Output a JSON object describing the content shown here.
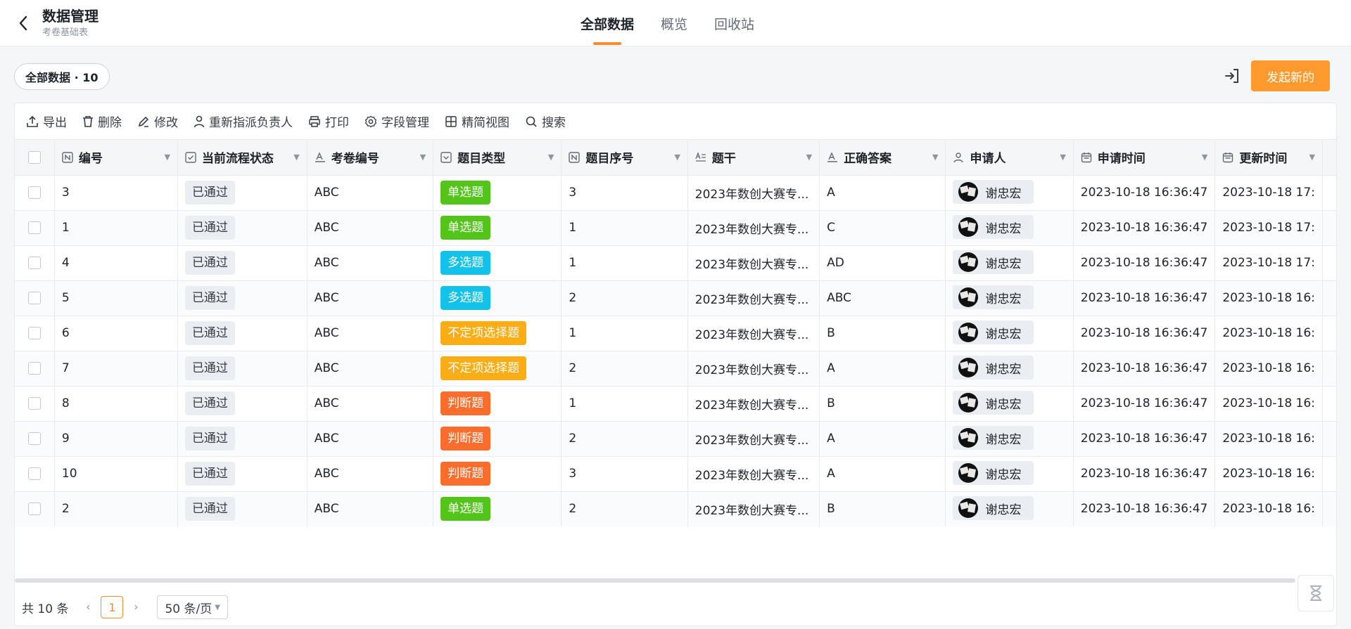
{
  "header": {
    "title": "数据管理",
    "subtitle": "考卷基础表",
    "tabs": [
      {
        "label": "全部数据",
        "active": true
      },
      {
        "label": "概览",
        "active": false
      },
      {
        "label": "回收站",
        "active": false
      }
    ]
  },
  "view_pill": "全部数据 · 10",
  "new_button": "发起新的",
  "actions": [
    "导出",
    "删除",
    "修改",
    "重新指派负责人",
    "打印",
    "字段管理",
    "精简视图",
    "搜索"
  ],
  "columns": [
    "编号",
    "当前流程状态",
    "考卷编号",
    "题目类型",
    "题目序号",
    "题干",
    "正确答案",
    "申请人",
    "申请时间",
    "更新时间"
  ],
  "type_colors": {
    "单选题": "#52c41a",
    "多选题": "#13c2e8",
    "不定项选择题": "#faad14",
    "判断题": "#fa6d2d"
  },
  "accent_color": "#ff8a2a",
  "rows": [
    {
      "id": "3",
      "status": "已通过",
      "paper": "ABC",
      "type": "单选题",
      "seq": "3",
      "stem": "2023年数创大赛专...",
      "answer": "A",
      "applicant": "谢忠宏",
      "apply_time": "2023-10-18 16:36:47",
      "update_time": "2023-10-18 17:"
    },
    {
      "id": "1",
      "status": "已通过",
      "paper": "ABC",
      "type": "单选题",
      "seq": "1",
      "stem": "2023年数创大赛专...",
      "answer": "C",
      "applicant": "谢忠宏",
      "apply_time": "2023-10-18 16:36:47",
      "update_time": "2023-10-18 17:"
    },
    {
      "id": "4",
      "status": "已通过",
      "paper": "ABC",
      "type": "多选题",
      "seq": "1",
      "stem": "2023年数创大赛专...",
      "answer": "AD",
      "applicant": "谢忠宏",
      "apply_time": "2023-10-18 16:36:47",
      "update_time": "2023-10-18 17:"
    },
    {
      "id": "5",
      "status": "已通过",
      "paper": "ABC",
      "type": "多选题",
      "seq": "2",
      "stem": "2023年数创大赛专...",
      "answer": "ABC",
      "applicant": "谢忠宏",
      "apply_time": "2023-10-18 16:36:47",
      "update_time": "2023-10-18 16:"
    },
    {
      "id": "6",
      "status": "已通过",
      "paper": "ABC",
      "type": "不定项选择题",
      "seq": "1",
      "stem": "2023年数创大赛专...",
      "answer": "B",
      "applicant": "谢忠宏",
      "apply_time": "2023-10-18 16:36:47",
      "update_time": "2023-10-18 16:"
    },
    {
      "id": "7",
      "status": "已通过",
      "paper": "ABC",
      "type": "不定项选择题",
      "seq": "2",
      "stem": "2023年数创大赛专...",
      "answer": "A",
      "applicant": "谢忠宏",
      "apply_time": "2023-10-18 16:36:47",
      "update_time": "2023-10-18 16:"
    },
    {
      "id": "8",
      "status": "已通过",
      "paper": "ABC",
      "type": "判断题",
      "seq": "1",
      "stem": "2023年数创大赛专...",
      "answer": "B",
      "applicant": "谢忠宏",
      "apply_time": "2023-10-18 16:36:47",
      "update_time": "2023-10-18 16:"
    },
    {
      "id": "9",
      "status": "已通过",
      "paper": "ABC",
      "type": "判断题",
      "seq": "2",
      "stem": "2023年数创大赛专...",
      "answer": "A",
      "applicant": "谢忠宏",
      "apply_time": "2023-10-18 16:36:47",
      "update_time": "2023-10-18 16:"
    },
    {
      "id": "10",
      "status": "已通过",
      "paper": "ABC",
      "type": "判断题",
      "seq": "3",
      "stem": "2023年数创大赛专...",
      "answer": "A",
      "applicant": "谢忠宏",
      "apply_time": "2023-10-18 16:36:47",
      "update_time": "2023-10-18 16:"
    },
    {
      "id": "2",
      "status": "已通过",
      "paper": "ABC",
      "type": "单选题",
      "seq": "2",
      "stem": "2023年数创大赛专...",
      "answer": "B",
      "applicant": "谢忠宏",
      "apply_time": "2023-10-18 16:36:47",
      "update_time": "2023-10-18 16:"
    }
  ],
  "pagination": {
    "total": "共 10 条",
    "current_page": "1",
    "page_size": "50 条/页"
  }
}
